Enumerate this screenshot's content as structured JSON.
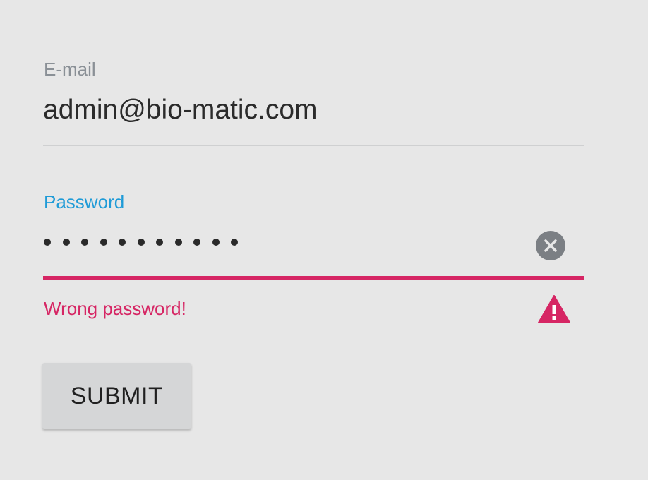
{
  "form": {
    "email": {
      "label": "E-mail",
      "value": "admin@bio-matic.com"
    },
    "password": {
      "label": "Password",
      "masked_length": 11,
      "error_message": "Wrong password!",
      "clear_icon": "clear-circle-icon",
      "error_icon": "warning-triangle-icon"
    },
    "submit_label": "SUBMIT"
  },
  "colors": {
    "background": "#e7e7e7",
    "label_inactive": "#8a9096",
    "label_focused": "#1f9bd7",
    "error": "#d62664",
    "underline": "#cfd0d1",
    "button_bg": "#d5d6d7"
  }
}
